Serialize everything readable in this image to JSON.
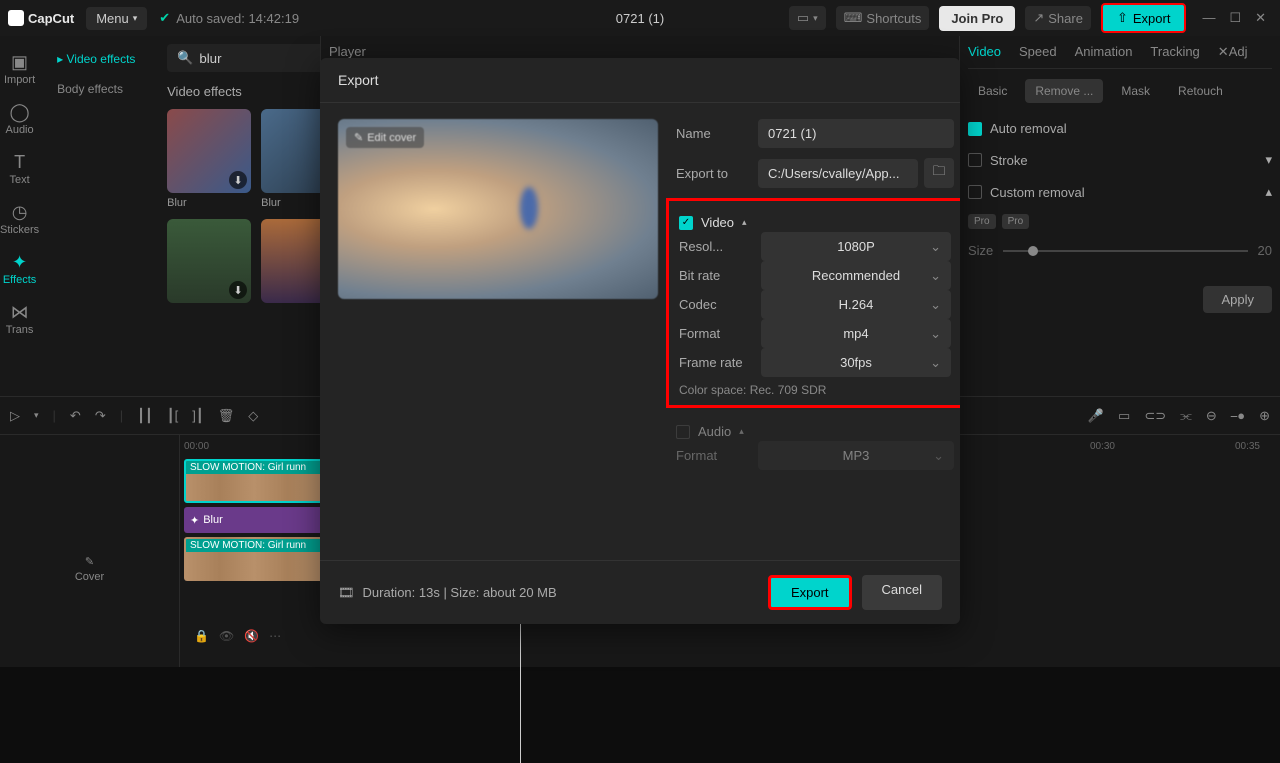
{
  "topbar": {
    "logo": "CapCut",
    "menu": "Menu",
    "autosave": "Auto saved: 14:42:19",
    "project": "0721 (1)",
    "shortcuts": "Shortcuts",
    "join_pro": "Join Pro",
    "share": "Share",
    "export": "Export"
  },
  "media_tabs": {
    "import": "Import",
    "audio": "Audio",
    "text": "Text",
    "stickers": "Stickers",
    "effects": "Effects",
    "transitions": "Trans"
  },
  "effects_sidebar": {
    "video_effects": "Video effects",
    "body_effects": "Body effects"
  },
  "search": {
    "value": "blur"
  },
  "effects_section": "Video effects",
  "thumbs": [
    {
      "label": "Blur"
    },
    {
      "label": "Blur"
    },
    {
      "label": ""
    },
    {
      "label": ""
    }
  ],
  "player": "Player",
  "right_tabs": {
    "video": "Video",
    "speed": "Speed",
    "animation": "Animation",
    "tracking": "Tracking",
    "adj": "Adj"
  },
  "sub_tabs": {
    "basic": "Basic",
    "remove": "Remove ...",
    "mask": "Mask",
    "retouch": "Retouch"
  },
  "right_panel": {
    "auto_removal": "Auto removal",
    "stroke": "Stroke",
    "custom_removal": "Custom removal",
    "size_label": "Size",
    "size_value": "20",
    "pro": "Pro",
    "apply": "Apply"
  },
  "timeline": {
    "ruler": [
      "00:00",
      "00:30",
      "00:35"
    ],
    "cover": "Cover",
    "clip1": "SLOW MOTION: Girl runn",
    "fx": "Blur",
    "clip2": "SLOW MOTION: Girl runn"
  },
  "modal": {
    "title": "Export",
    "edit_cover": "Edit cover",
    "name_label": "Name",
    "name_value": "0721 (1)",
    "exportto_label": "Export to",
    "exportto_value": "C:/Users/cvalley/App...",
    "video_section": "Video",
    "resolution_label": "Resol...",
    "resolution_value": "1080P",
    "bitrate_label": "Bit rate",
    "bitrate_value": "Recommended",
    "codec_label": "Codec",
    "codec_value": "H.264",
    "format_label": "Format",
    "format_value": "mp4",
    "framerate_label": "Frame rate",
    "framerate_value": "30fps",
    "colorspace": "Color space: Rec. 709 SDR",
    "audio_section": "Audio",
    "audio_format_label": "Format",
    "audio_format_value": "MP3",
    "duration": "Duration: 13s | Size: about 20 MB",
    "export_btn": "Export",
    "cancel_btn": "Cancel"
  }
}
